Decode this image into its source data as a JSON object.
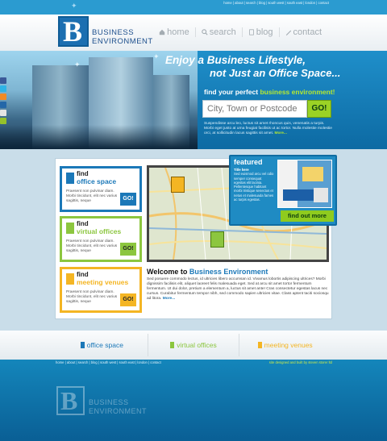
{
  "top_links": "home | about | search | blog | south west | south east | london | contact",
  "logo": {
    "mark": "B",
    "line1": "BUSINESS",
    "line2": "ENVIRONMENT"
  },
  "nav": [
    {
      "label": "home",
      "icon": "house-icon"
    },
    {
      "label": "search",
      "icon": "magnifier-icon"
    },
    {
      "label": "blog",
      "icon": "pencil-icon"
    },
    {
      "label": "contact",
      "icon": "pen-icon"
    }
  ],
  "hero": {
    "headline1": "Enjoy a Business Lifestyle,",
    "headline2": "not Just an Office Space...",
    "find_prefix": "find your perfect",
    "find_highlight": "business environment!",
    "search_placeholder": "City, Town or Postcode",
    "go_label": "GO!",
    "paragraph": "Suspendisse arcu leo, luctus sit amet rhoncus quis, venenatis a turpis. Morbi eget justo at urna feugiat facilisis ut ac tortor. Nulla molestie molestie orci, at sollicitudin lacus sagittis sit amet.",
    "more": "More..."
  },
  "social_icons": [
    "facebook-icon",
    "twitter-icon",
    "rss-icon",
    "digg-icon",
    "email-icon",
    "share-icon"
  ],
  "boxes": [
    {
      "find": "find",
      "type": "office space",
      "color": "#1b78b8",
      "desc": "Praesent non pulvinar diam. Morbi tincidunt, elit nec varius sagittis, neque",
      "go": "GO!"
    },
    {
      "find": "find",
      "type": "virtual offices",
      "color": "#8cc63f",
      "desc": "Praesent non pulvinar diam. Morbi tincidunt, elit nec varius sagittis, neque",
      "go": "GO!"
    },
    {
      "find": "find",
      "type": "meeting venues",
      "color": "#f4b523",
      "desc": "Praesent non pulvinar diam. Morbi tincidunt, elit nec varius sagittis, neque",
      "go": "GO!"
    }
  ],
  "featured": {
    "title": "featured",
    "subtitle": "Title here",
    "body": "Sed euismod arcu vel odio semper consequat egestas elit lacinia. Pellentesque habitant morbi tristique senectus et netus et malesuada fames ac turpis egestas.",
    "button": "find out more"
  },
  "welcome": {
    "prefix": "Welcome to",
    "brand": "Business Environment",
    "body": "Sed posuere commodo lectus, id ultricies libero accumsan id. Vivamus lobortis adipiscing ultrices? Morbi dignissim facilisis elit, aliquet laoreet felis malesuada eget. Sed at arcu sit amet tortor fermentum fermentum. Ut dui dolor, pretium a elementum a, luctus sit amet ante! Cras consectetur egestas lacus nec cursus. Curabitur fermentum tempor nibh, sed commodo sapien ultricies vitae. Class aptent taciti sociosqu ad litora.",
    "more": "More..."
  },
  "bottom_bar": [
    {
      "label": "office space",
      "color": "#1b78b8"
    },
    {
      "label": "virtual offices",
      "color": "#8cc63f"
    },
    {
      "label": "meeting venues",
      "color": "#f4b523"
    }
  ],
  "footer": {
    "links": "home | about | search | blog | south west | south east | london | contact",
    "credit": "site designed and built by steven storer ltd"
  }
}
